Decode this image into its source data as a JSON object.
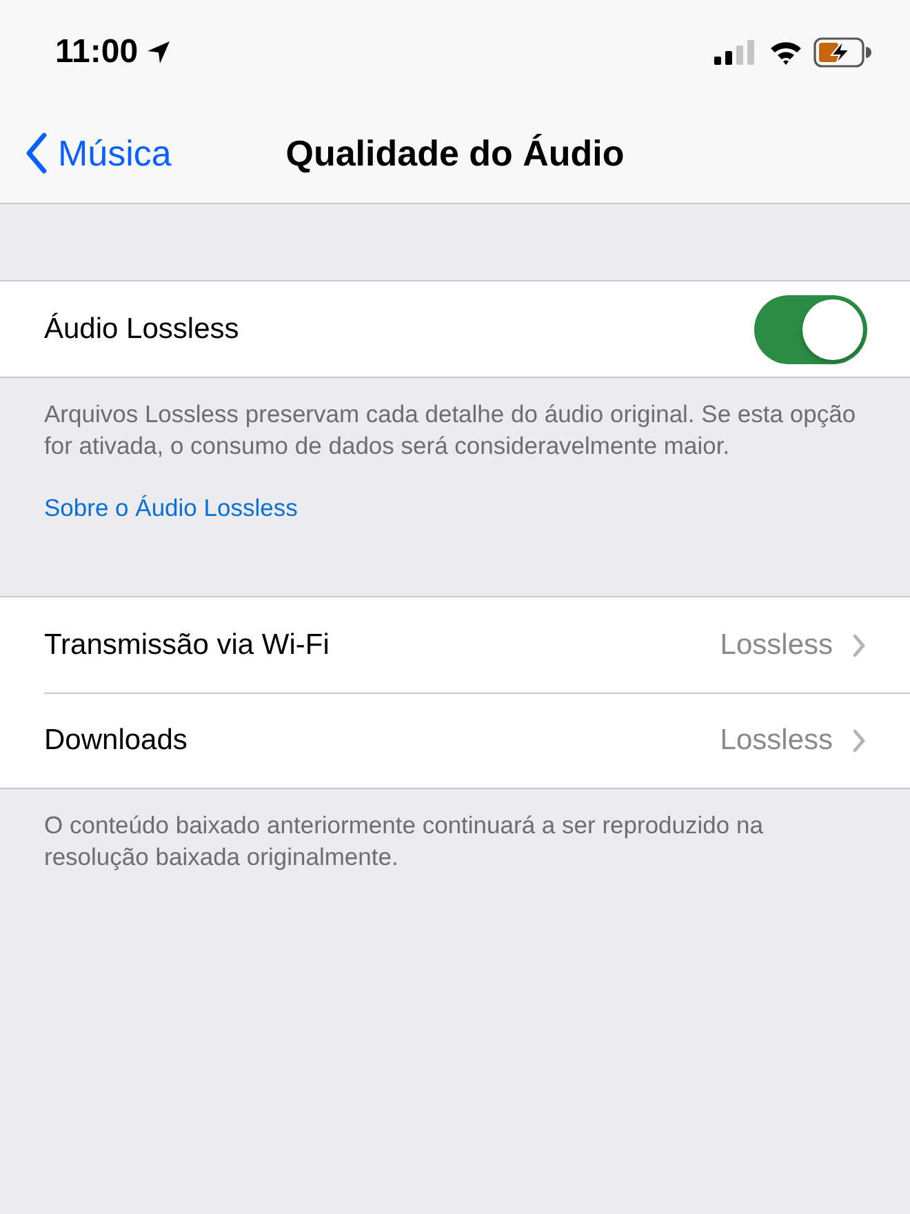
{
  "status_bar": {
    "time": "11:00"
  },
  "nav": {
    "back": "Música",
    "title": "Qualidade do Áudio"
  },
  "sections": [
    {
      "rows": [
        {
          "kind": "toggle",
          "label": "Áudio Lossless",
          "on": true
        }
      ],
      "footer": "Arquivos Lossless preservam cada detalhe do áudio original. Se esta opção for ativada, o consumo de dados será consideravelmente maior.",
      "footer_link": "Sobre o Áudio Lossless"
    },
    {
      "rows": [
        {
          "kind": "disclosure",
          "label": "Transmissão via Wi-Fi",
          "value": "Lossless"
        },
        {
          "kind": "disclosure",
          "label": "Downloads",
          "value": "Lossless"
        }
      ],
      "footer": "O conteúdo baixado anteriormente continuará a ser reproduzido na resolução baixada originalmente."
    }
  ]
}
